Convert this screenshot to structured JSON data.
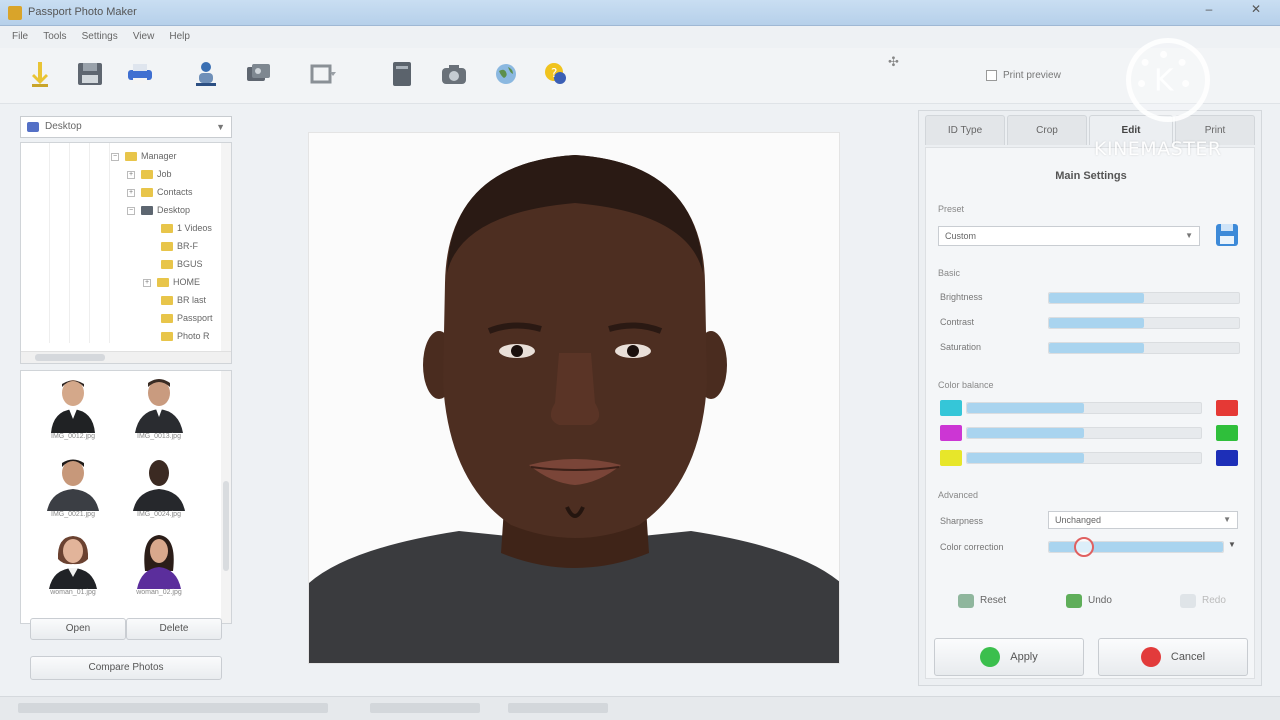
{
  "window": {
    "title": "Passport Photo Maker",
    "minimize": "–",
    "close": "✕"
  },
  "menu": [
    "File",
    "Tools",
    "Settings",
    "View",
    "Help"
  ],
  "toolbar": {
    "icons": [
      "open-icon",
      "save-icon",
      "print-icon",
      "person-icon",
      "photos-icon",
      "crop-icon",
      "book-icon",
      "camera-icon",
      "globe-icon",
      "help-icon"
    ],
    "preview_label": "Print preview"
  },
  "browser": {
    "folder_select": "Desktop",
    "tree": [
      {
        "label": "Manager",
        "indent": 0
      },
      {
        "label": "Job",
        "indent": 1
      },
      {
        "label": "Contacts",
        "indent": 1
      },
      {
        "label": "Desktop",
        "indent": 0
      },
      {
        "label": "1 Videos",
        "indent": 1
      },
      {
        "label": "BR-F",
        "indent": 1
      },
      {
        "label": "BGUS",
        "indent": 1
      },
      {
        "label": "HOME",
        "indent": 1
      },
      {
        "label": "BR last",
        "indent": 1
      },
      {
        "label": "Passport",
        "indent": 1
      },
      {
        "label": "Photo R",
        "indent": 1
      }
    ],
    "thumbnails": [
      {
        "caption": "IMG_0012.jpg"
      },
      {
        "caption": "IMG_0013.jpg"
      },
      {
        "caption": "IMG_0021.jpg"
      },
      {
        "caption": "IMG_0024.jpg"
      },
      {
        "caption": "woman_01.jpg"
      },
      {
        "caption": "woman_02.jpg"
      }
    ],
    "open_label": "Open",
    "delete_label": "Delete",
    "compare_label": "Compare Photos"
  },
  "panel": {
    "tabs": [
      "ID Type",
      "Crop",
      "Edit",
      "Print"
    ],
    "active_tab": 2,
    "heading": "Main Settings",
    "preset_label": "Preset",
    "preset_value": "Custom",
    "basic_label": "Basic",
    "sliders": [
      {
        "label": "Brightness",
        "value": 0.5
      },
      {
        "label": "Contrast",
        "value": 0.5
      },
      {
        "label": "Saturation",
        "value": 0.5
      }
    ],
    "color_balance_label": "Color balance",
    "color_balance": [
      {
        "left": "#35c6d8",
        "right": "#e53935",
        "value": 0.5
      },
      {
        "left": "#cc36d4",
        "right": "#2fbf3b",
        "value": 0.5
      },
      {
        "left": "#e7e62a",
        "right": "#1d2fb8",
        "value": 0.5
      }
    ],
    "advanced_label": "Advanced",
    "sharpness_label": "Sharpness",
    "sharpness_value": "Unchanged",
    "color_correction_label": "Color correction",
    "color_correction_value": 0.2,
    "reset_label": "Reset",
    "undo_label": "Undo",
    "redo_label": "Redo",
    "apply_label": "Apply",
    "cancel_label": "Cancel"
  },
  "watermark": "KINEMASTER"
}
